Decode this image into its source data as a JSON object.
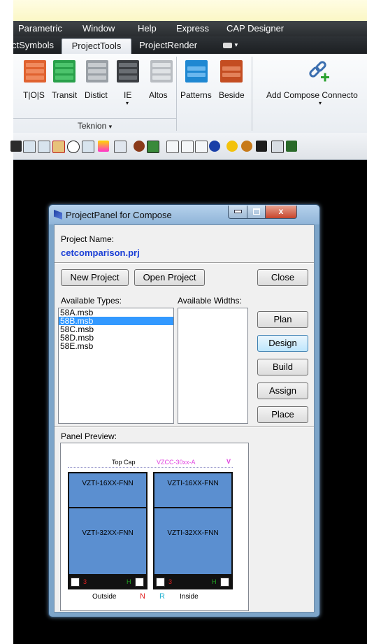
{
  "menubar": {
    "items": [
      "Parametric",
      "Window",
      "Help",
      "Express",
      "CAP Designer"
    ]
  },
  "ribbon_tabs": {
    "items": [
      "ctSymbols",
      "ProjectTools",
      "ProjectRender"
    ],
    "active": "ProjectTools"
  },
  "ribbon": {
    "buttons": [
      "T|O|S",
      "Transit",
      "Distict",
      "IE",
      "Altos",
      "Patterns",
      "Beside",
      "Add Compose Connecto"
    ],
    "panel_label": "Teknion",
    "colors": {
      "orange": "#e0622f",
      "green": "#29a04a",
      "gray": "#9aa0a6",
      "dark": "#3b3e42",
      "blue": "#1f88d2",
      "brown": "#c44d21"
    }
  },
  "dialog": {
    "title": "ProjectPanel for Compose",
    "close_glyph": "x",
    "project_name_label": "Project Name:",
    "project_name": "cetcomparison.prj",
    "new_project": "New Project",
    "open_project": "Open Project",
    "close": "Close",
    "available_types_label": "Available Types:",
    "available_widths_label": "Available Widths:",
    "types": [
      "58A.msb",
      "58B.msb",
      "58C.msb",
      "58D.msb",
      "58E.msb"
    ],
    "selected_type": "58B.msb",
    "actions": [
      "Plan",
      "Design",
      "Build",
      "Assign",
      "Place"
    ],
    "panel_preview_label": "Panel Preview:",
    "preview": {
      "top_cap": "Top Cap",
      "vzcc": "VZCC-30xx-A",
      "vzcc_mark": "V",
      "left_top": "VZTI-16XX-FNN",
      "left_bottom": "VZTI-32XX-FNN",
      "right_top": "VZTI-16XX-FNN",
      "right_bottom": "VZTI-32XX-FNN",
      "left_foot_l": "3",
      "left_foot_r": "H",
      "right_foot_l": "3",
      "right_foot_r": "H",
      "outside": "Outside",
      "n_mark": "N",
      "r_mark": "R",
      "inside": "Inside",
      "colors": {
        "cell": "#5b8fd0",
        "magenta": "#e040e0",
        "red": "#e02020",
        "green": "#22aa22",
        "cyan": "#20b0d0"
      }
    }
  }
}
